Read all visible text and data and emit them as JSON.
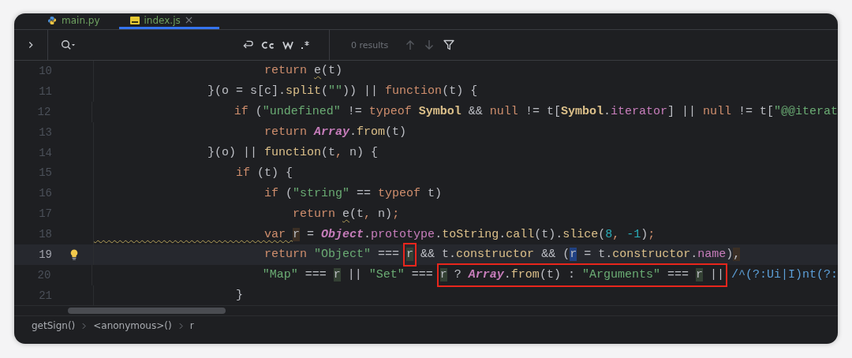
{
  "tabs": [
    {
      "label": "main.py",
      "kind": "python",
      "selected": false
    },
    {
      "label": "index.js",
      "kind": "js",
      "selected": true
    }
  ],
  "search": {
    "results": "0 results"
  },
  "lines": [
    {
      "number": "10",
      "current": false,
      "tokens": [
        {
          "kind": "kw",
          "text": "                        return "
        },
        {
          "kind": "warn",
          "text": "e"
        },
        {
          "kind": "plain",
          "text": "(t)"
        }
      ]
    },
    {
      "number": "11",
      "current": false,
      "tokens": [
        {
          "kind": "plain",
          "text": "                }(o = s[c]."
        },
        {
          "kind": "call",
          "text": "split"
        },
        {
          "kind": "plain",
          "text": "("
        },
        {
          "kind": "str",
          "text": "\"\""
        },
        {
          "kind": "plain",
          "text": ")) || "
        },
        {
          "kind": "kw",
          "text": "function"
        },
        {
          "kind": "plain",
          "text": "(t) {"
        }
      ]
    },
    {
      "number": "12",
      "current": false,
      "tokens": [
        {
          "kind": "kw",
          "text": "                    if "
        },
        {
          "kind": "plain",
          "text": "("
        },
        {
          "kind": "str",
          "text": "\"undefined\""
        },
        {
          "kind": "plain",
          "text": " != "
        },
        {
          "kind": "kw",
          "text": "typeof "
        },
        {
          "kind": "sym",
          "text": "Symbol"
        },
        {
          "kind": "plain",
          "text": " && "
        },
        {
          "kind": "kw",
          "text": "null"
        },
        {
          "kind": "plain",
          "text": " != t["
        },
        {
          "kind": "sym",
          "text": "Symbol"
        },
        {
          "kind": "plain",
          "text": "."
        },
        {
          "kind": "prop",
          "text": "iterator"
        },
        {
          "kind": "plain",
          "text": "] || "
        },
        {
          "kind": "kw",
          "text": "null"
        },
        {
          "kind": "plain",
          "text": " != t["
        },
        {
          "kind": "str",
          "text": "\"@@iterat"
        }
      ]
    },
    {
      "number": "13",
      "current": false,
      "tokens": [
        {
          "kind": "kw",
          "text": "                        return "
        },
        {
          "kind": "cls",
          "text": "Array"
        },
        {
          "kind": "plain",
          "text": "."
        },
        {
          "kind": "call",
          "text": "from"
        },
        {
          "kind": "plain",
          "text": "(t)"
        }
      ]
    },
    {
      "number": "14",
      "current": false,
      "tokens": [
        {
          "kind": "plain",
          "text": "                }(o) || "
        },
        {
          "kind": "call",
          "text": "function"
        },
        {
          "kind": "plain",
          "text": "(t"
        },
        {
          "kind": "kw",
          "text": ","
        },
        {
          "kind": "plain",
          "text": " n) {"
        }
      ]
    },
    {
      "number": "15",
      "current": false,
      "tokens": [
        {
          "kind": "kw",
          "text": "                    if "
        },
        {
          "kind": "plain",
          "text": "(t) {"
        }
      ]
    },
    {
      "number": "16",
      "current": false,
      "tokens": [
        {
          "kind": "kw",
          "text": "                        if "
        },
        {
          "kind": "plain",
          "text": "("
        },
        {
          "kind": "str",
          "text": "\"string\""
        },
        {
          "kind": "plain",
          "text": " == "
        },
        {
          "kind": "kw",
          "text": "typeof "
        },
        {
          "kind": "plain",
          "text": "t)"
        }
      ]
    },
    {
      "number": "17",
      "current": false,
      "tokens": [
        {
          "kind": "kw",
          "text": "                            return "
        },
        {
          "kind": "warn",
          "text": "e"
        },
        {
          "kind": "plain",
          "text": "(t"
        },
        {
          "kind": "kw",
          "text": ","
        },
        {
          "kind": "plain",
          "text": " n)"
        },
        {
          "kind": "kw",
          "text": ";"
        }
      ]
    },
    {
      "number": "18",
      "current": false,
      "tokens": [
        {
          "kind": "kwwarn",
          "text": "                        var "
        },
        {
          "kind": "decl",
          "text": "r"
        },
        {
          "kind": "plain",
          "text": " = "
        },
        {
          "kind": "cls",
          "text": "Object"
        },
        {
          "kind": "plain",
          "text": "."
        },
        {
          "kind": "prop",
          "text": "prototype"
        },
        {
          "kind": "plain",
          "text": "."
        },
        {
          "kind": "call",
          "text": "toString"
        },
        {
          "kind": "plain",
          "text": "."
        },
        {
          "kind": "call",
          "text": "call"
        },
        {
          "kind": "plain",
          "text": "(t)."
        },
        {
          "kind": "call",
          "text": "slice"
        },
        {
          "kind": "plain",
          "text": "("
        },
        {
          "kind": "num",
          "text": "8"
        },
        {
          "kind": "kw",
          "text": ", "
        },
        {
          "kind": "num",
          "text": "-1"
        },
        {
          "kind": "plain",
          "text": ")"
        },
        {
          "kind": "kw",
          "text": ";"
        }
      ]
    },
    {
      "number": "19",
      "current": true,
      "tokens": [
        {
          "kind": "kw",
          "text": "                        return "
        },
        {
          "kind": "str",
          "text": "\"Object\""
        },
        {
          "kind": "plain",
          "text": " === "
        },
        {
          "kind": "box",
          "tokens": [
            {
              "kind": "occ",
              "text": "r"
            }
          ]
        },
        {
          "kind": "plain",
          "text": " && t."
        },
        {
          "kind": "call",
          "text": "constructor"
        },
        {
          "kind": "plain",
          "text": " && ("
        },
        {
          "kind": "sel",
          "text": "r"
        },
        {
          "kind": "plain",
          "text": " = t."
        },
        {
          "kind": "call",
          "text": "constructor"
        },
        {
          "kind": "plain",
          "text": "."
        },
        {
          "kind": "prop",
          "text": "name"
        },
        {
          "kind": "plain",
          "text": ")"
        },
        {
          "kind": "decl",
          "text": ","
        }
      ]
    },
    {
      "number": "20",
      "current": false,
      "tokens": [
        {
          "kind": "str",
          "text": "                        \"Map\""
        },
        {
          "kind": "plain",
          "text": " === "
        },
        {
          "kind": "occ",
          "text": "r"
        },
        {
          "kind": "plain",
          "text": " || "
        },
        {
          "kind": "str",
          "text": "\"Set\""
        },
        {
          "kind": "plain",
          "text": " === "
        },
        {
          "kind": "box",
          "tokens": [
            {
              "kind": "occ",
              "text": "r"
            },
            {
              "kind": "plain",
              "text": " ? "
            },
            {
              "kind": "cls",
              "text": "Array"
            },
            {
              "kind": "plain",
              "text": "."
            },
            {
              "kind": "call",
              "text": "from"
            },
            {
              "kind": "plain",
              "text": "(t) : "
            },
            {
              "kind": "str",
              "text": "\"Arguments\""
            },
            {
              "kind": "plain",
              "text": " === "
            },
            {
              "kind": "occ",
              "text": "r"
            },
            {
              "kind": "plain",
              "text": " ||"
            }
          ]
        },
        {
          "kind": "regex",
          "text": " /^(?:Ui|I)nt(?:"
        }
      ]
    },
    {
      "number": "21",
      "current": false,
      "tokens": [
        {
          "kind": "plain",
          "text": "                    }"
        }
      ]
    }
  ],
  "breadcrumbs": [
    "getSign()",
    "<anonymous>()",
    "r"
  ]
}
